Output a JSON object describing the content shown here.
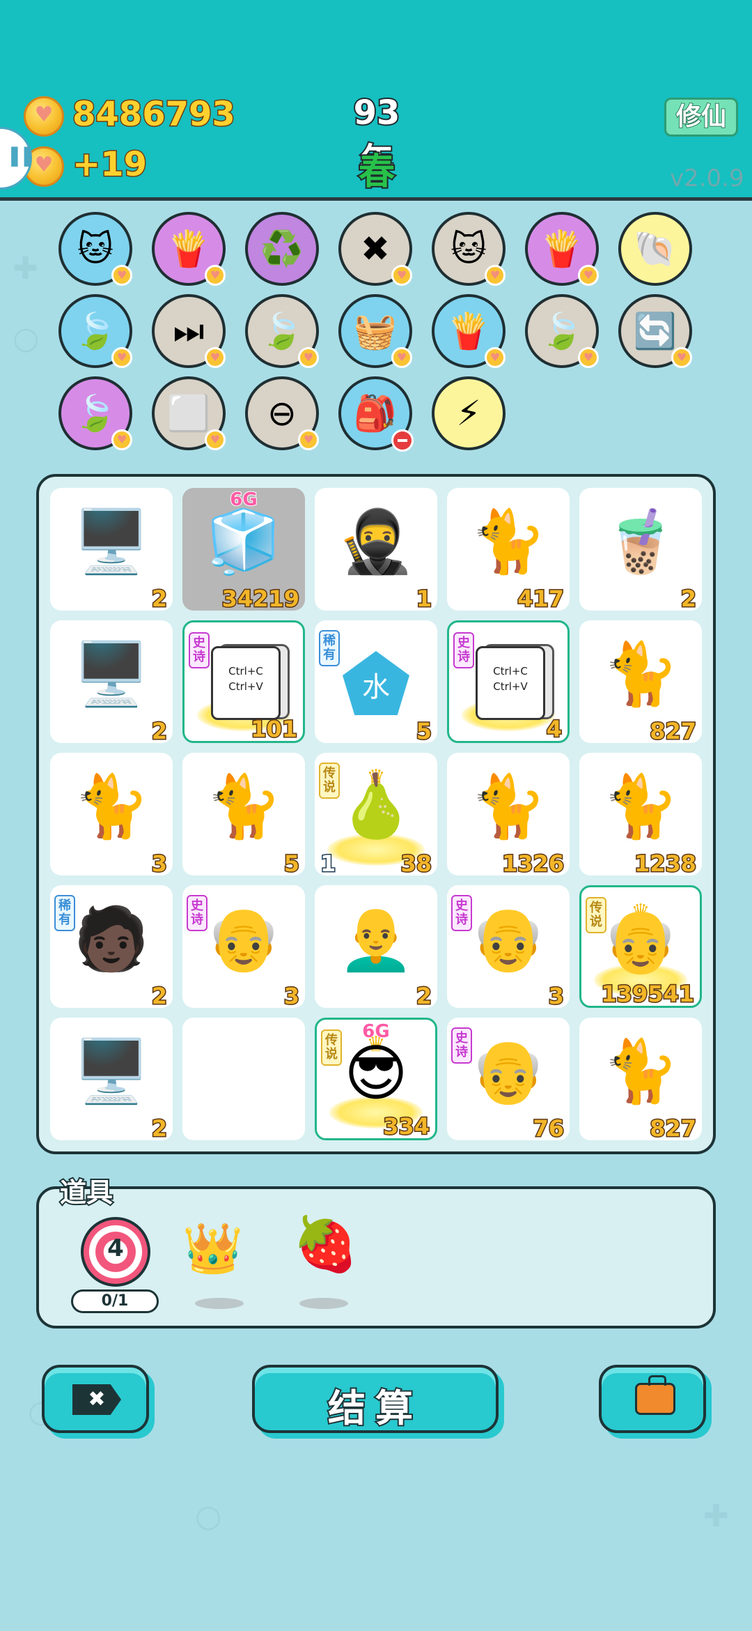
{
  "header": {
    "gold": "8486793",
    "income": "+19",
    "year": "93年",
    "season": "春",
    "xiuxian_label": "修仙",
    "version": "v2.0.9"
  },
  "skills": [
    {
      "icon": "🐱",
      "bg": "#7fd3ee",
      "badge": "coin"
    },
    {
      "icon": "🍟",
      "bg": "#d68ce6",
      "badge": "coin"
    },
    {
      "icon": "♻️",
      "bg": "#c186e0",
      "badge": "none"
    },
    {
      "icon": "✖",
      "bg": "#d9d2c6",
      "badge": "coin"
    },
    {
      "icon": "🐱",
      "bg": "#d9d2c6",
      "badge": "coin"
    },
    {
      "icon": "🍟",
      "bg": "#d68ce6",
      "badge": "coin"
    },
    {
      "icon": "🐚",
      "bg": "#fdf59c",
      "badge": "none"
    },
    {
      "icon": "🍃",
      "bg": "#7fd3ee",
      "badge": "coin"
    },
    {
      "icon": "⏭",
      "bg": "#d9d2c6",
      "badge": "coin"
    },
    {
      "icon": "🍃",
      "bg": "#d9d2c6",
      "badge": "coin"
    },
    {
      "icon": "🧺",
      "bg": "#7fd3ee",
      "badge": "coin"
    },
    {
      "icon": "🍟",
      "bg": "#7fd3ee",
      "badge": "coin"
    },
    {
      "icon": "🍃",
      "bg": "#d9d2c6",
      "badge": "coin"
    },
    {
      "icon": "🔄",
      "bg": "#d9d2c6",
      "badge": "coin"
    },
    {
      "icon": "🍃",
      "bg": "#d68ce6",
      "badge": "coin"
    },
    {
      "icon": "⬜",
      "bg": "#d9d2c6",
      "badge": "coin"
    },
    {
      "icon": "⊖",
      "bg": "#d9d2c6",
      "badge": "coin"
    },
    {
      "icon": "🎒",
      "bg": "#7fd3ee",
      "badge": "no"
    },
    {
      "icon": "⚡",
      "bg": "#fdf59c",
      "badge": "none"
    }
  ],
  "board": [
    {
      "art": "🖥️",
      "count": "2"
    },
    {
      "art": "🧊",
      "count": "34219",
      "gray": true,
      "sixg": "6G"
    },
    {
      "art": "🥷",
      "count": "1"
    },
    {
      "art": "🐈",
      "count": "417"
    },
    {
      "art": "🧋",
      "count": "2"
    },
    {
      "art": "🖥️",
      "count": "2"
    },
    {
      "art": "ctrl",
      "count": "101",
      "tag": "史诗",
      "tagType": "epic",
      "gold": true,
      "ctrl": [
        "Ctrl+C",
        "Ctrl+V"
      ]
    },
    {
      "art": "⬟",
      "count": "5",
      "tag": "稀有",
      "tagType": "rare",
      "water": "水"
    },
    {
      "art": "ctrl",
      "count": "4",
      "tag": "史诗",
      "tagType": "epic",
      "gold": true,
      "ctrl": [
        "Ctrl+C",
        "Ctrl+V"
      ]
    },
    {
      "art": "🐈",
      "count": "827"
    },
    {
      "art": "🐈",
      "count": "3"
    },
    {
      "art": "🐈",
      "count": "5"
    },
    {
      "art": "🍐",
      "count": "38",
      "tag": "传说",
      "tagType": "legend",
      "crown": true,
      "left": "1"
    },
    {
      "art": "🐈",
      "count": "1326"
    },
    {
      "art": "🐈",
      "count": "1238"
    },
    {
      "art": "🧑🏿",
      "count": "2",
      "tag": "稀有",
      "tagType": "rare"
    },
    {
      "art": "👴",
      "count": "3",
      "tag": "史诗",
      "tagType": "epic"
    },
    {
      "art": "👨‍🦲",
      "count": "2"
    },
    {
      "art": "👴",
      "count": "3",
      "tag": "史诗",
      "tagType": "epic"
    },
    {
      "art": "👴",
      "count": "139541",
      "tag": "传说",
      "tagType": "legend",
      "crown": true,
      "gold": true
    },
    {
      "art": "🖥️",
      "count": "2"
    },
    {
      "art": "",
      "count": ""
    },
    {
      "art": "😎",
      "count": "334",
      "tag": "传说",
      "tagType": "legend",
      "crown": true,
      "gold": true,
      "sixg": "6G"
    },
    {
      "art": "👴",
      "count": "76",
      "tag": "史诗",
      "tagType": "epic"
    },
    {
      "art": "🐈",
      "count": "827"
    }
  ],
  "props": {
    "label": "道具",
    "target_number": "4",
    "target_progress": "0/1",
    "items": [
      {
        "icon": "👑",
        "name": "crown"
      },
      {
        "icon": "🍓",
        "name": "bayberry"
      }
    ]
  },
  "buttons": {
    "quit_label": "✖",
    "settle_label": "结算"
  }
}
